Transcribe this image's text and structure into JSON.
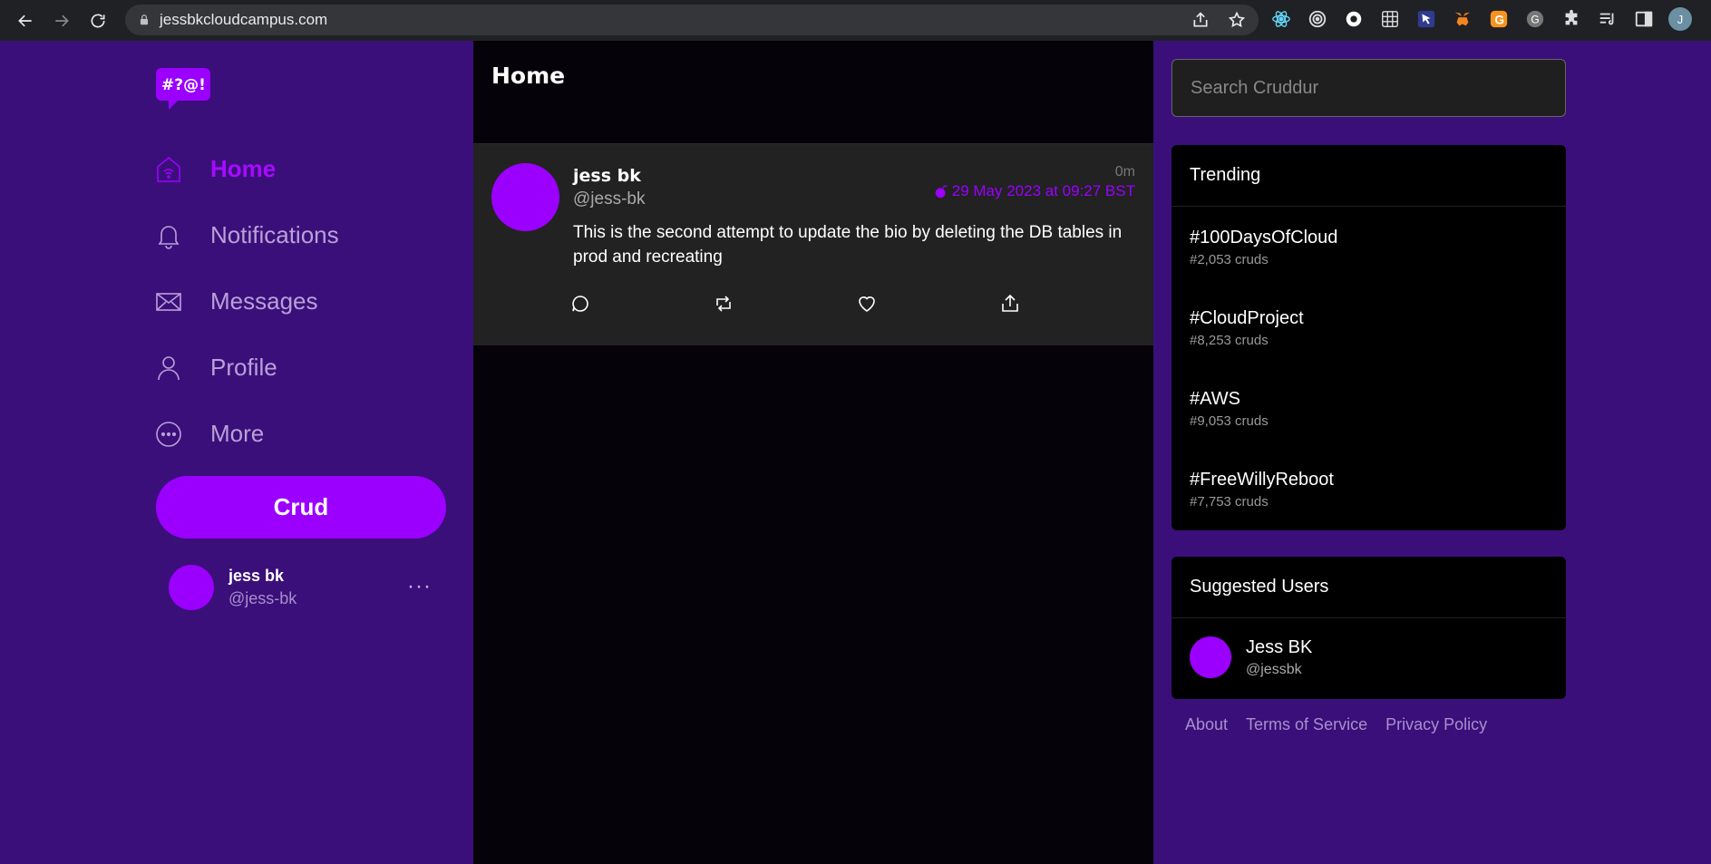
{
  "browser": {
    "url": "jessbkcloudcampus.com",
    "profile_initial": "J"
  },
  "sidebar": {
    "logo_text": "#?@!",
    "items": [
      {
        "label": "Home",
        "icon": "home-icon",
        "active": true
      },
      {
        "label": "Notifications",
        "icon": "bell-icon",
        "active": false
      },
      {
        "label": "Messages",
        "icon": "envelope-icon",
        "active": false
      },
      {
        "label": "Profile",
        "icon": "person-icon",
        "active": false
      },
      {
        "label": "More",
        "icon": "more-circle-icon",
        "active": false
      }
    ],
    "crud_label": "Crud",
    "user": {
      "name": "jess bk",
      "handle": "@jess-bk",
      "more": "···"
    }
  },
  "feed": {
    "title": "Home",
    "posts": [
      {
        "name": "jess bk",
        "handle": "@jess-bk",
        "ago": "0m",
        "expires": "29 May 2023 at 09:27 BST",
        "text": "This is the second attempt to update the bio by deleting the DB tables in prod and recreating"
      }
    ]
  },
  "search": {
    "placeholder": "Search Cruddur"
  },
  "trending": {
    "title": "Trending",
    "items": [
      {
        "tag": "#100DaysOfCloud",
        "count": "#2,053 cruds"
      },
      {
        "tag": "#CloudProject",
        "count": "#8,253 cruds"
      },
      {
        "tag": "#AWS",
        "count": "#9,053 cruds"
      },
      {
        "tag": "#FreeWillyReboot",
        "count": "#7,753 cruds"
      }
    ]
  },
  "suggested": {
    "title": "Suggested Users",
    "users": [
      {
        "name": "Jess BK",
        "handle": "@jessbk"
      }
    ]
  },
  "footer": {
    "about": "About",
    "terms": "Terms of Service",
    "privacy": "Privacy Policy"
  },
  "colors": {
    "accent": "#9b00ff",
    "background": "#3b0f7a",
    "feed": "#060209"
  }
}
